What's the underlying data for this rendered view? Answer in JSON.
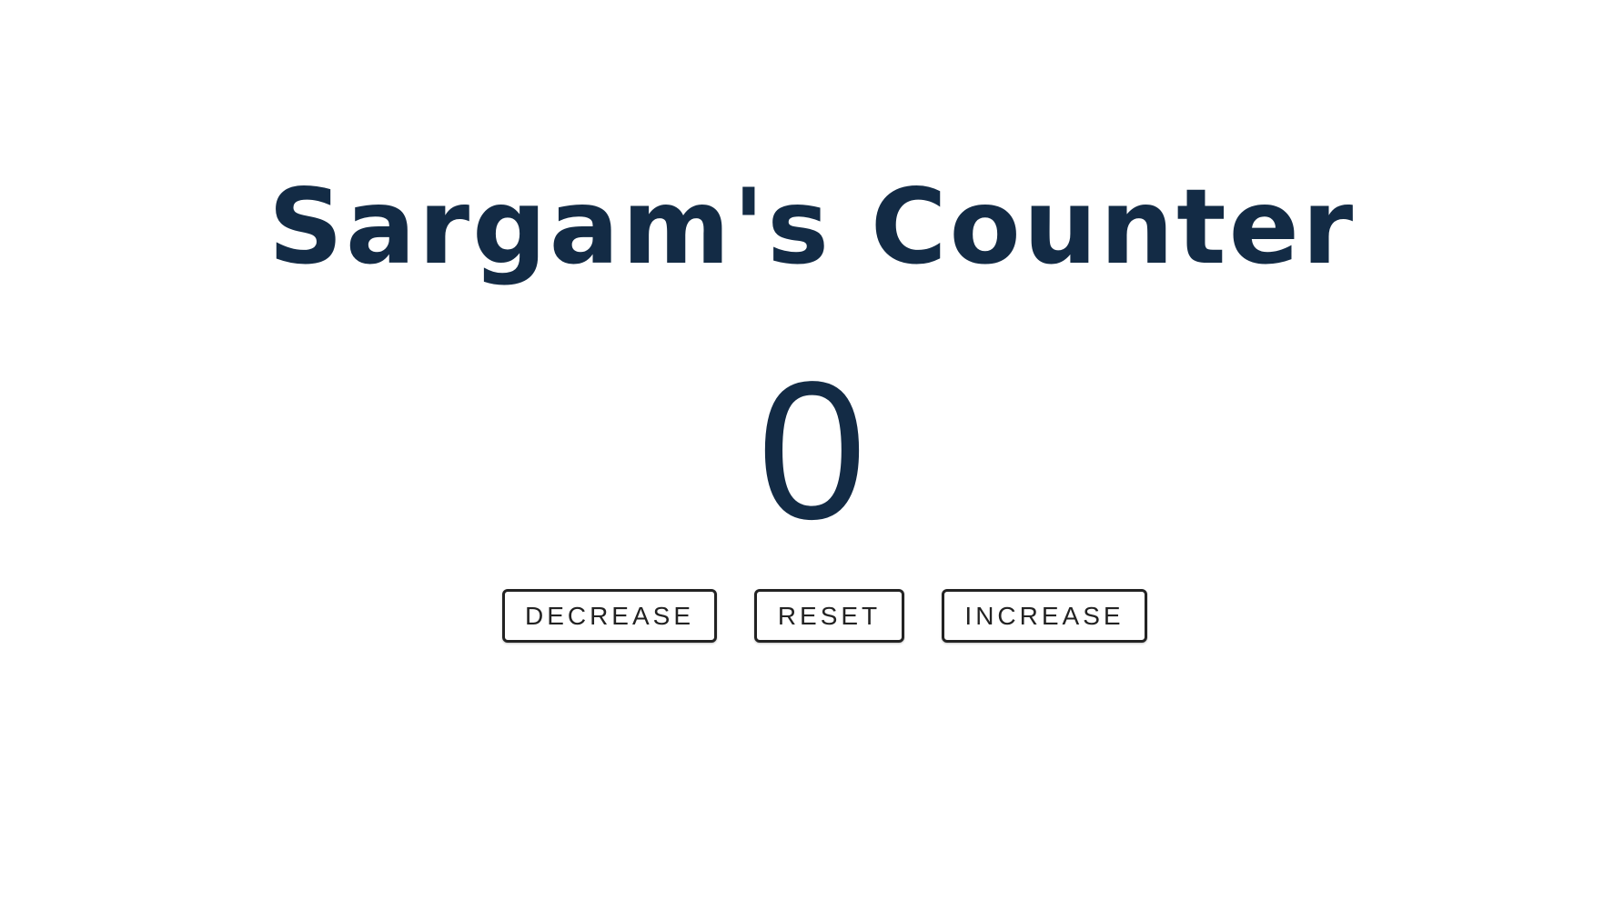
{
  "header": {
    "title": "Sargam's Counter"
  },
  "counter": {
    "value": "0"
  },
  "controls": {
    "decrease_label": "DECREASE",
    "reset_label": "RESET",
    "increase_label": "INCREASE"
  },
  "colors": {
    "text_primary": "#132b45",
    "button_border": "#222222",
    "background": "#ffffff"
  }
}
